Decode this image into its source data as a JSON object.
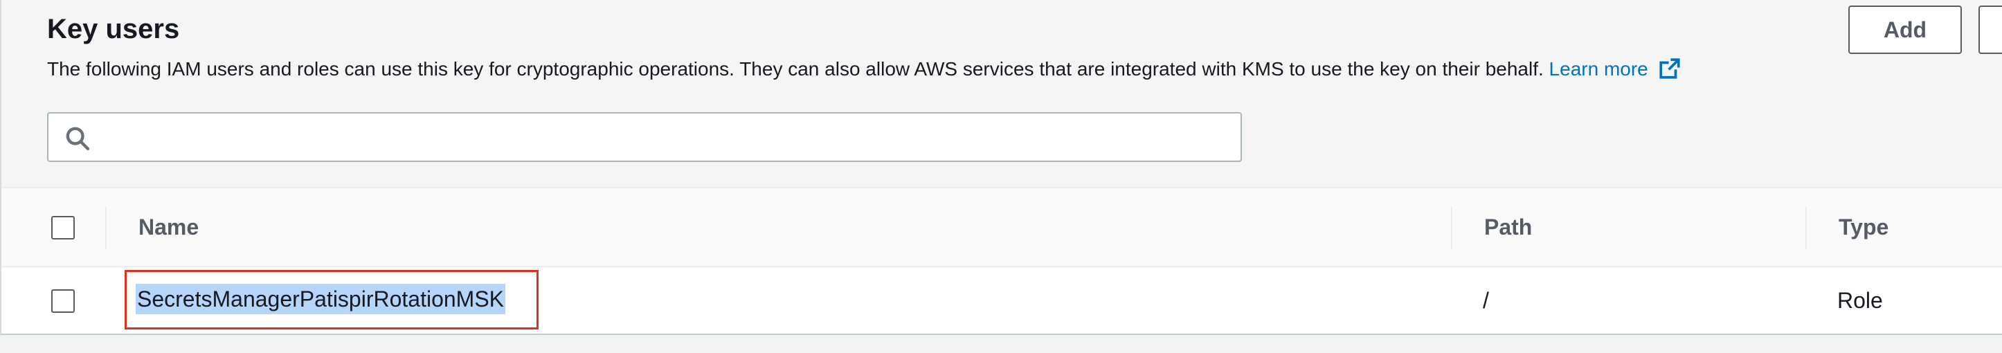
{
  "section": {
    "title": "Key users",
    "description": "The following IAM users and roles can use this key for cryptographic operations. They can also allow AWS services that are integrated with KMS to use the key on their behalf.",
    "learn_more": "Learn more",
    "add_label": "Add"
  },
  "search": {
    "placeholder": "",
    "value": ""
  },
  "table": {
    "columns": [
      "Name",
      "Path",
      "Type"
    ],
    "rows": [
      {
        "name": "SecretsManagerPatispirRotationMSK",
        "path": "/",
        "type": "Role",
        "selected": false
      }
    ]
  },
  "colors": {
    "link": "#0073bb",
    "highlight_border": "#e0301e",
    "text_selection": "#b5d5fb"
  },
  "icons": [
    "search-icon",
    "external-link-icon"
  ]
}
